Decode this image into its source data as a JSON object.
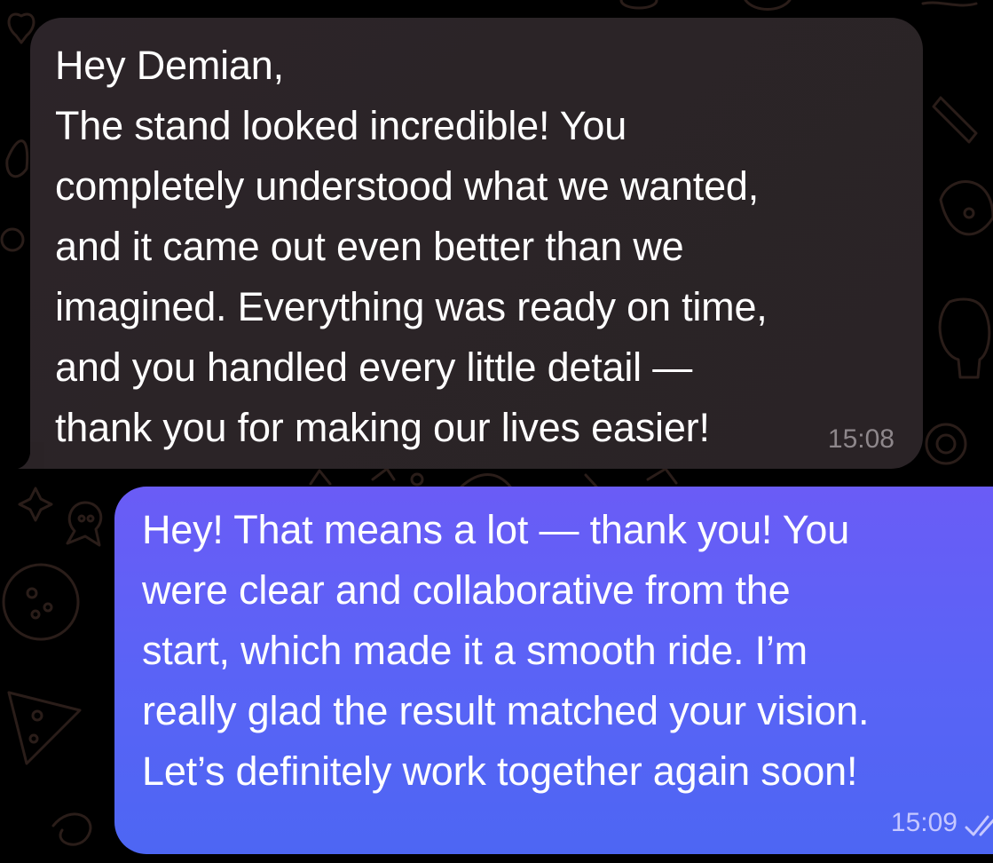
{
  "conversation": {
    "messages": [
      {
        "direction": "incoming",
        "text": "Hey Demian,\nThe stand looked incredible! You\ncompletely understood what we wanted,\nand it came out even better than we\nimagined. Everything was ready on time,\nand you handled every little detail —\nthank you for making our lives easier!",
        "time": "15:08"
      },
      {
        "direction": "outgoing",
        "text": "Hey! That means a lot — thank you! You\nwere clear and collaborative from the\nstart, which made it a smooth ride. I’m\nreally glad the result matched your vision.\nLet’s definitely work together again soon!",
        "time": "15:09",
        "status_icon": "double-check-icon"
      }
    ]
  },
  "colors": {
    "background": "#000000",
    "incoming_bubble": "#2b2427",
    "outgoing_bubble_top": "#6a5cf6",
    "outgoing_bubble_bottom": "#4d66f3",
    "doodle_stroke": "#2a1d19"
  }
}
